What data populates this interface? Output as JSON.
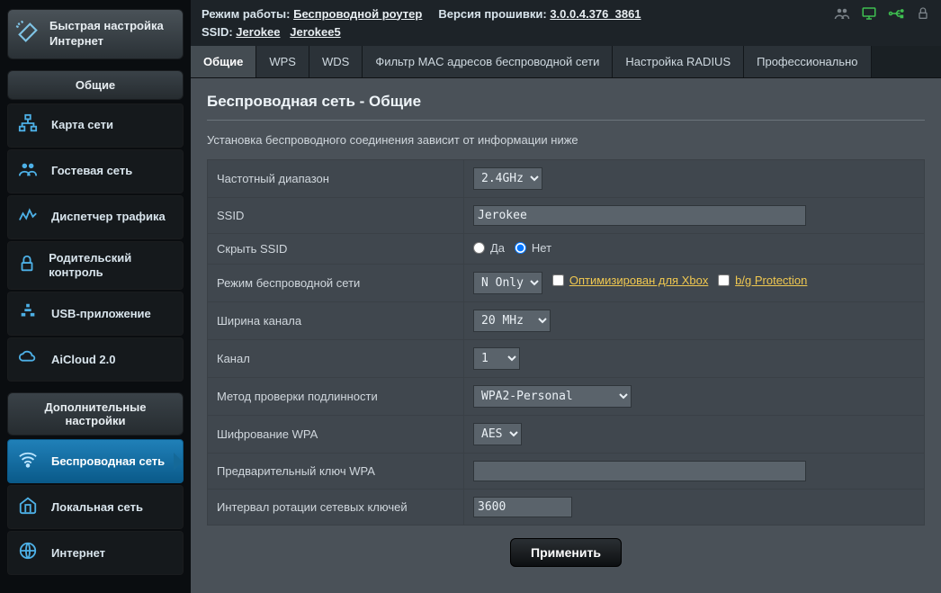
{
  "topbar": {
    "mode_label": "Режим работы:",
    "mode_value": "Беспроводной роутер",
    "fw_label": "Версия прошивки:",
    "fw_value": "3.0.0.4.376_3861",
    "ssid_label": "SSID:",
    "ssid1": "Jerokee",
    "ssid2": "Jerokee5"
  },
  "sidebar": {
    "wizard": "Быстрая настройка Интернет",
    "section_general": "Общие",
    "items_general": [
      {
        "label": "Карта сети",
        "icon": "network-map-icon"
      },
      {
        "label": "Гостевая сеть",
        "icon": "guest-network-icon"
      },
      {
        "label": "Диспетчер трафика",
        "icon": "traffic-manager-icon"
      },
      {
        "label": "Родительский контроль",
        "icon": "parental-control-icon"
      },
      {
        "label": "USB-приложение",
        "icon": "usb-app-icon"
      },
      {
        "label": "AiCloud 2.0",
        "icon": "aicloud-icon"
      }
    ],
    "section_advanced": "Дополнительные настройки",
    "items_advanced": [
      {
        "label": "Беспроводная сеть",
        "icon": "wireless-icon",
        "active": true
      },
      {
        "label": "Локальная сеть",
        "icon": "lan-icon"
      },
      {
        "label": "Интернет",
        "icon": "internet-icon"
      }
    ]
  },
  "tabs": [
    "Общие",
    "WPS",
    "WDS",
    "Фильтр MAC адресов беспроводной сети",
    "Настройка RADIUS",
    "Профессионально"
  ],
  "panel": {
    "title": "Беспроводная сеть - Общие",
    "desc": "Установка беспроводного соединения зависит от информации ниже",
    "rows": {
      "band_label": "Частотный диапазон",
      "band_value": "2.4GHz",
      "ssid_label": "SSID",
      "ssid_value": "Jerokee",
      "hide_label": "Скрыть SSID",
      "hide_yes": "Да",
      "hide_no": "Нет",
      "mode_label": "Режим беспроводной сети",
      "mode_value": "N Only",
      "mode_xbox": "Оптимизирован для Xbox",
      "mode_bg": "b/g Protection",
      "width_label": "Ширина канала",
      "width_value": "20 MHz",
      "channel_label": "Канал",
      "channel_value": "1",
      "auth_label": "Метод проверки подлинности",
      "auth_value": "WPA2-Personal",
      "enc_label": "Шифрование WPA",
      "enc_value": "AES",
      "psk_label": "Предварительный ключ WPA",
      "psk_value": "",
      "rekey_label": "Интервал ротации сетевых ключей",
      "rekey_value": "3600"
    },
    "apply": "Применить"
  }
}
